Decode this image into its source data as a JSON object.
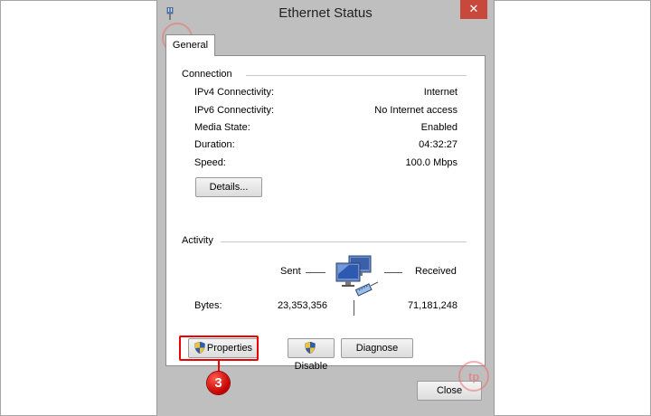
{
  "window": {
    "title": "Ethernet Status",
    "close_glyph": "✕"
  },
  "tabs": [
    {
      "label": "General"
    }
  ],
  "connection": {
    "group_label": "Connection",
    "rows": [
      {
        "label": "IPv4 Connectivity:",
        "value": "Internet"
      },
      {
        "label": "IPv6 Connectivity:",
        "value": "No Internet access"
      },
      {
        "label": "Media State:",
        "value": "Enabled"
      },
      {
        "label": "Duration:",
        "value": "04:32:27"
      },
      {
        "label": "Speed:",
        "value": "100.0 Mbps"
      }
    ],
    "details_button": "Details..."
  },
  "activity": {
    "group_label": "Activity",
    "sent_label": "Sent",
    "received_label": "Received",
    "bytes_label": "Bytes:",
    "bytes_sent": "23,353,356",
    "bytes_received": "71,181,248"
  },
  "buttons": {
    "properties": "Properties",
    "disable": "Disable",
    "diagnose": "Diagnose",
    "close": "Close"
  },
  "annotation": {
    "step": "3"
  },
  "icons": {
    "app": "network-icon",
    "activity": "network-computers-icon",
    "shield": "uac-shield-icon",
    "watermark": "watermark-logo-icon"
  },
  "colors": {
    "window_frame": "#bfbfbf",
    "close_button": "#c9483c",
    "highlight": "#e00000"
  }
}
